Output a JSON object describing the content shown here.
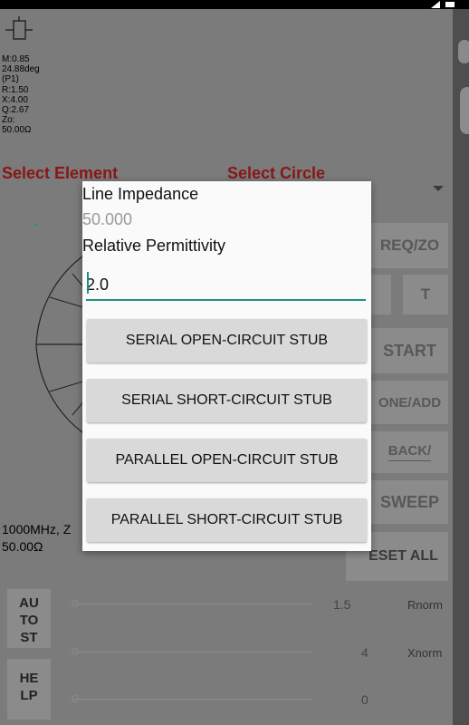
{
  "readouts": [
    "M:0.85",
    "24.88deg",
    "(P1)",
    "R:1.50",
    "X:4.00",
    "Q:2.67",
    "Zo:",
    "50.00Ω"
  ],
  "select_element_label": "Select Element",
  "select_circle_label": "Select Circle",
  "right_buttons": {
    "freq_zo": "REQ/ZO",
    "t": "T",
    "start": "START",
    "done_add": "ONE/ADD",
    "back": "BACK/",
    "sweep": "SWEEP",
    "reset_all": "ESET ALL"
  },
  "bottom_info": {
    "freq_line": "1000MHz, Z",
    "zo_line": "50.00Ω"
  },
  "side_buttons": {
    "auto_lines": [
      "AU",
      "TO",
      "ST"
    ],
    "help_lines": [
      "HE",
      "LP"
    ]
  },
  "sliders": [
    {
      "value_text": "1.5",
      "name": "Rnorm"
    },
    {
      "value_text": "4",
      "name": "Xnorm"
    },
    {
      "value_text": "0",
      "name": ""
    }
  ],
  "dialog": {
    "line_impedance_label": "Line Impedance",
    "line_impedance_value": "50.000",
    "permittivity_label": "Relative Permittivity",
    "permittivity_value": "2.0",
    "buttons": [
      "SERIAL OPEN-CIRCUIT STUB",
      "SERIAL SHORT-CIRCUIT STUB",
      "PARALLEL OPEN-CIRCUIT STUB",
      "PARALLEL SHORT-CIRCUIT STUB"
    ]
  },
  "colors": {
    "accent_teal": "#1d8f87",
    "select_red": "#8a1616",
    "dim_overlay_bg": "#7b7b7b"
  },
  "icons": [
    "circuit-element-icon",
    "dropdown-arrow-icon",
    "smith-chart-icon",
    "signal-icon",
    "battery-icon"
  ]
}
